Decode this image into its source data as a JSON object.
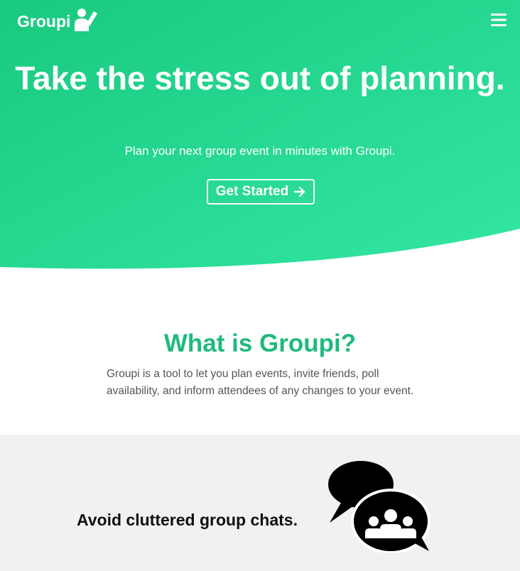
{
  "colors": {
    "gradient_start": "#19c97f",
    "gradient_end": "#33e6a2",
    "accent": "#1fba7c",
    "feature_bg": "#f1f1f1"
  },
  "header": {
    "logo_text": "Groupi",
    "logo_icon": "waving-person-icon",
    "menu_icon": "hamburger-menu-icon"
  },
  "hero": {
    "title": "Take the stress out of planning.",
    "subtitle": "Plan your next group event in minutes with Groupi.",
    "cta_label": "Get Started",
    "cta_icon": "arrow-right-icon"
  },
  "about": {
    "title": "What is Groupi?",
    "text": "Groupi is a tool to let you plan events, invite friends, poll availability, and inform attendees of any changes to your event."
  },
  "feature": {
    "title": "Avoid cluttered group chats.",
    "icon": "group-chat-icon"
  }
}
